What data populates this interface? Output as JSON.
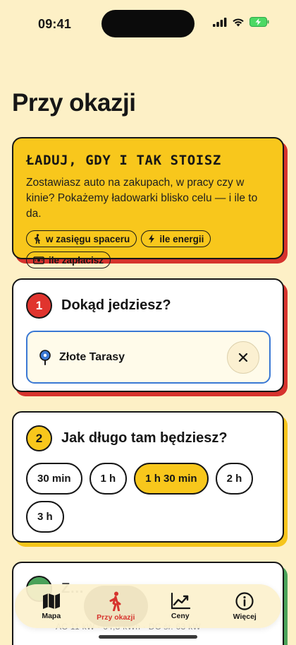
{
  "status_bar": {
    "time": "09:41"
  },
  "page": {
    "title": "Przy okazji"
  },
  "hero": {
    "title": "Ładuj, gdy i tak stoisz",
    "description": "Zostawiasz auto na zakupach, w pracy czy w kinie? Pokażemy ładowarki blisko celu — i ile to da.",
    "chips": [
      {
        "icon": "walking-icon",
        "label": "w zasięgu spaceru"
      },
      {
        "icon": "lightning-icon",
        "label": "ile energii"
      },
      {
        "icon": "banknote-icon",
        "label": "ile zapłacisz"
      }
    ]
  },
  "step1": {
    "number": "1",
    "title": "Dokąd jedziesz?",
    "destination": "Złote Tarasy"
  },
  "step2": {
    "number": "2",
    "title": "Jak długo tam będziesz?",
    "options": [
      "30 min",
      "1 h",
      "1 h 30 min",
      "2 h",
      "3 h"
    ],
    "selected": "1 h 30 min"
  },
  "step3": {
    "title_partial": "Z…",
    "sub": "AC 11 kW · 64,8 kWh · DC śr. 63 kW"
  },
  "tabbar": {
    "tabs": [
      {
        "icon": "map-icon",
        "label": "Mapa",
        "active": false
      },
      {
        "icon": "walking-icon",
        "label": "Przy okazji",
        "active": true
      },
      {
        "icon": "chart-icon",
        "label": "Ceny",
        "active": false
      },
      {
        "icon": "info-icon",
        "label": "Więcej",
        "active": false
      }
    ]
  },
  "colors": {
    "background": "#fdf0c6",
    "accent_yellow": "#f8c71c",
    "accent_red": "#d6332d",
    "accent_blue": "#3a78d4",
    "accent_green": "#4aa35a"
  }
}
